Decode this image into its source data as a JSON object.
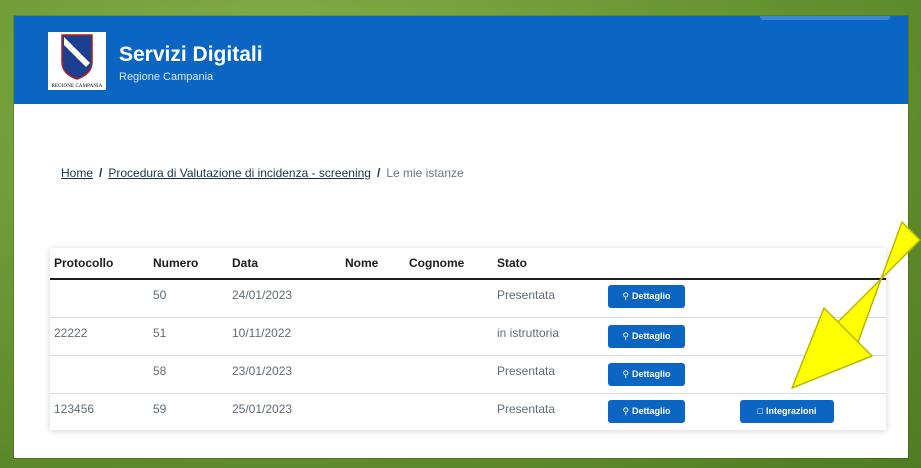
{
  "header": {
    "title": "Servizi Digitali",
    "subtitle": "Regione Campania",
    "logo_caption": "REGIONE CAMPANIA",
    "background": "#0b66c3"
  },
  "breadcrumb": {
    "home": "Home",
    "procedure": "Procedura di Valutazione di incidenza - screening",
    "current": "Le mie istanze",
    "separator": "/"
  },
  "table": {
    "columns": [
      "Protocollo",
      "Numero",
      "Data",
      "Nome",
      "Cognome",
      "Stato"
    ],
    "rows": [
      {
        "protocollo": "",
        "numero": "50",
        "data": "24/01/2023",
        "nome": "",
        "cognome": "",
        "stato": "Presentata",
        "detail_label": "Dettaglio"
      },
      {
        "protocollo": "22222",
        "numero": "51",
        "data": "10/11/2022",
        "nome": "",
        "cognome": "",
        "stato": "in istruttoria",
        "detail_label": "Dettaglio"
      },
      {
        "protocollo": "",
        "numero": "58",
        "data": "23/01/2023",
        "nome": "",
        "cognome": "",
        "stato": "Presentata",
        "detail_label": "Dettaglio"
      },
      {
        "protocollo": "123456",
        "numero": "59",
        "data": "25/01/2023",
        "nome": "",
        "cognome": "",
        "stato": "Presentata",
        "detail_label": "Dettaglio",
        "integration_label": "Integrazioni"
      }
    ]
  },
  "icons": {
    "search": "search-icon",
    "comment": "comment-icon",
    "annotation_arrow": "arrow-icon"
  },
  "colors": {
    "primary": "#0b66c3",
    "annotation": "#ffff00",
    "frame": "#6b9834"
  }
}
